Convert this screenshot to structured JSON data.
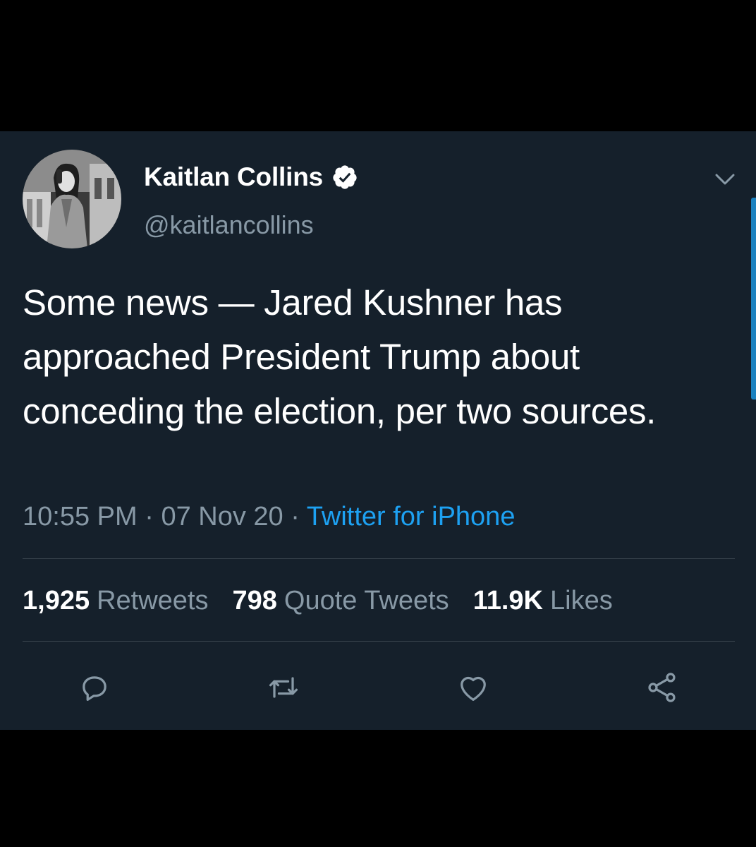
{
  "user": {
    "display_name": "Kaitlan Collins",
    "handle": "@kaitlancollins",
    "verified": true
  },
  "tweet": {
    "text": "Some news — Jared Kushner has approached President Trump about conceding the election, per two sources.",
    "time": "10:55 PM",
    "separator_1": "·",
    "date": "07 Nov 20",
    "separator_2": "·",
    "source": "Twitter for iPhone"
  },
  "stats": {
    "retweets_count": "1,925",
    "retweets_label": "Retweets",
    "quotes_count": "798",
    "quotes_label": "Quote Tweets",
    "likes_count": "11.9K",
    "likes_label": "Likes"
  },
  "icons": {
    "caret": "chevron-down-icon",
    "verified": "verified-badge-icon",
    "reply": "reply-icon",
    "retweet": "retweet-icon",
    "like": "heart-icon",
    "share": "share-icon"
  },
  "colors": {
    "background": "#15202b",
    "text": "#ffffff",
    "secondary_text": "#8899a6",
    "accent": "#1da1f2",
    "divider": "#38444d"
  }
}
